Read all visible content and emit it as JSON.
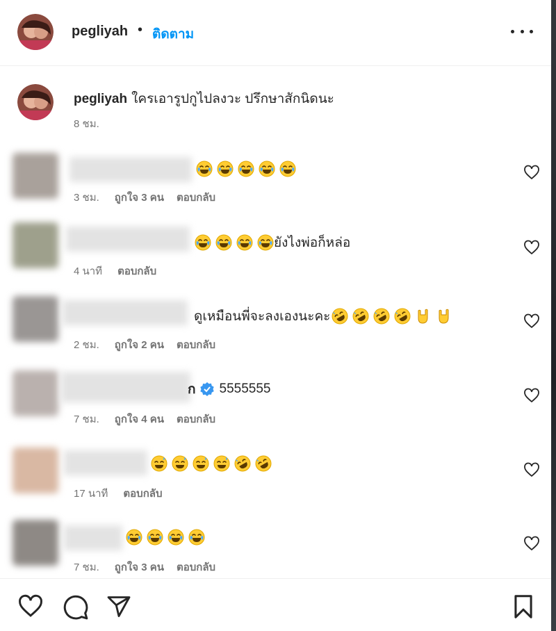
{
  "header": {
    "username": "pegliyah",
    "separator": "•",
    "follow_label": "ติดตาม"
  },
  "caption": {
    "username": "pegliyah",
    "text": "ใครเอารูปกูไปลงวะ ปรึกษาสักนิดนะ",
    "time": "8 ชม."
  },
  "comments": [
    {
      "text": "",
      "emojis": [
        "joy",
        "joy",
        "joy",
        "joy",
        "joy"
      ],
      "time": "3 ชม.",
      "likes": "ถูกใจ 3 คน",
      "reply": "ตอบกลับ"
    },
    {
      "text": "ยังไงพ่อก็หล่อ",
      "emojis_before": [
        "joy",
        "joy",
        "joy",
        "joy"
      ],
      "time": "4 นาที",
      "likes": "",
      "reply": "ตอบกลับ"
    },
    {
      "text": "ดูเหมือนพี่จะลงเองนะคะ",
      "emojis_after": [
        "rofl",
        "rofl",
        "rofl",
        "rofl",
        "metal",
        "metal"
      ],
      "time": "2 ชม.",
      "likes": "ถูกใจ 2 คน",
      "reply": "ตอบกลับ"
    },
    {
      "name_tail": "ก",
      "text": "5555555",
      "verified": true,
      "time": "7 ชม.",
      "likes": "ถูกใจ 4 คน",
      "reply": "ตอบกลับ"
    },
    {
      "text": "",
      "emojis": [
        "sweat-smile",
        "sweat-smile",
        "sweat-smile",
        "sweat-smile",
        "rofl",
        "rofl"
      ],
      "time": "17 นาที",
      "likes": "",
      "reply": "ตอบกลับ"
    },
    {
      "text": "",
      "emojis": [
        "joy",
        "joy",
        "joy",
        "joy"
      ],
      "time": "7 ชม.",
      "likes": "ถูกใจ 3 คน",
      "reply": "ตอบกลับ"
    }
  ],
  "actions": {
    "icons": [
      "heart-icon",
      "comment-icon",
      "share-icon",
      "bookmark-icon"
    ]
  },
  "colors": {
    "follow": "#0095f6",
    "muted": "#737373",
    "text": "#262626",
    "verified": "#3897f0",
    "emoji_face": "#ffcc33"
  }
}
